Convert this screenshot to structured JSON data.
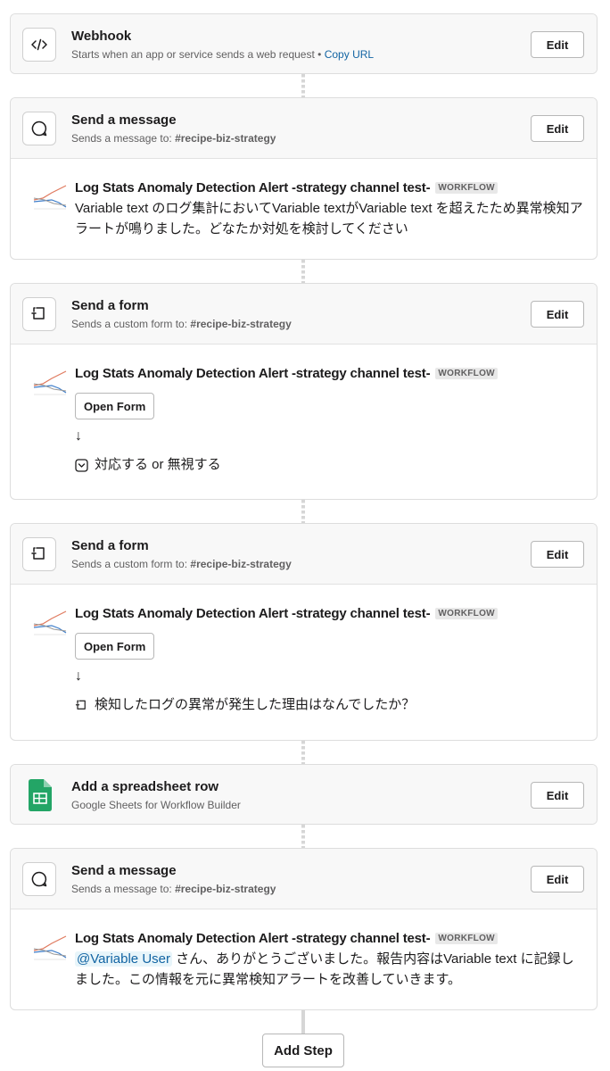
{
  "steps": [
    {
      "title": "Webhook",
      "subtitle": "Starts when an app or service sends a web request",
      "separator": "•",
      "link": "Copy URL",
      "icon": "code-icon",
      "edit_label": "Edit"
    },
    {
      "title": "Send a message",
      "subtitle_prefix": "Sends a message to:",
      "channel": "#recipe-biz-strategy",
      "icon": "message-bubble-icon",
      "edit_label": "Edit",
      "author": "Log Stats Anomaly Detection Alert -strategy channel test-",
      "badge": "WORKFLOW",
      "text": "Variable text のログ集計においてVariable textがVariable text を超えたため異常検知アラートが鳴りました。どなたか対処を検討してください"
    },
    {
      "title": "Send a form",
      "subtitle_prefix": "Sends a custom form to:",
      "channel": "#recipe-biz-strategy",
      "icon": "form-icon",
      "edit_label": "Edit",
      "author": "Log Stats Anomaly Detection Alert -strategy channel test-",
      "badge": "WORKFLOW",
      "button": "Open Form",
      "arrow": "↓",
      "form_item_icon": "dropdown-field-icon",
      "form_item": "対応する or 無視する"
    },
    {
      "title": "Send a form",
      "subtitle_prefix": "Sends a custom form to:",
      "channel": "#recipe-biz-strategy",
      "icon": "form-icon",
      "edit_label": "Edit",
      "author": "Log Stats Anomaly Detection Alert -strategy channel test-",
      "badge": "WORKFLOW",
      "button": "Open Form",
      "arrow": "↓",
      "form_item_icon": "text-field-icon",
      "form_item": "検知したログの異常が発生した理由はなんでしたか？"
    },
    {
      "title": "Add a spreadsheet row",
      "subtitle": "Google Sheets for Workflow Builder",
      "icon": "google-sheets-icon",
      "edit_label": "Edit"
    },
    {
      "title": "Send a message",
      "subtitle_prefix": "Sends a message to:",
      "channel": "#recipe-biz-strategy",
      "icon": "message-bubble-icon",
      "edit_label": "Edit",
      "author": "Log Stats Anomaly Detection Alert -strategy channel test-",
      "badge": "WORKFLOW",
      "mention": "@Variable User",
      "text": " さん、ありがとうございました。報告内容はVariable text に記録しました。この情報を元に異常検知アラートを改善していきます。"
    }
  ],
  "add_step_label": "Add Step",
  "colors": {
    "link": "#1264a3",
    "header_bg": "#f8f8f8",
    "border": "#dddddd",
    "sheets_green": "#23a566"
  }
}
